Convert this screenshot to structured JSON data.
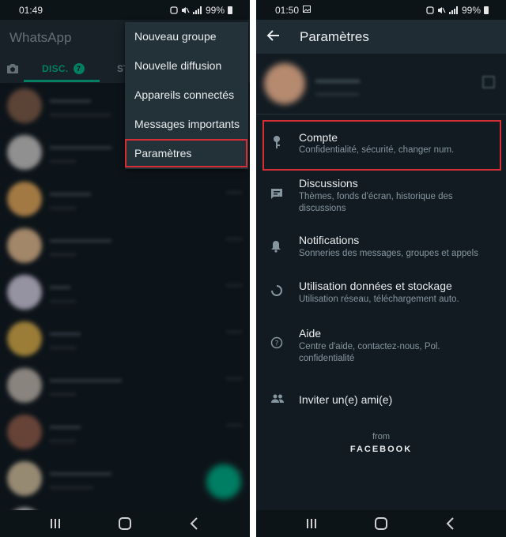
{
  "left_screen": {
    "status_bar": {
      "time": "01:49",
      "battery": "99%"
    },
    "app_title": "WhatsApp",
    "tabs": {
      "disc_label": "DISC.",
      "disc_badge": "7",
      "status_label": "ST"
    },
    "menu": {
      "items": [
        {
          "label": "Nouveau groupe"
        },
        {
          "label": "Nouvelle diffusion"
        },
        {
          "label": "Appareils connectés"
        },
        {
          "label": "Messages importants"
        },
        {
          "label": "Paramètres"
        }
      ],
      "highlighted_item": "Paramètres"
    },
    "chats_blurred": true
  },
  "right_screen": {
    "status_bar": {
      "time": "01:50",
      "battery": "99%"
    },
    "title": "Paramètres",
    "settings": [
      {
        "title": "Compte",
        "subtitle": "Confidentialité, sécurité, changer num.",
        "icon": "key-icon",
        "highlighted": true
      },
      {
        "title": "Discussions",
        "subtitle": "Thèmes, fonds d'écran, historique des discussions",
        "icon": "chat-icon"
      },
      {
        "title": "Notifications",
        "subtitle": "Sonneries des messages, groupes et appels",
        "icon": "bell-icon"
      },
      {
        "title": "Utilisation données et stockage",
        "subtitle": "Utilisation réseau, téléchargement auto.",
        "icon": "data-usage-icon"
      },
      {
        "title": "Aide",
        "subtitle": "Centre d'aide, contactez-nous, Pol. confidentialité",
        "icon": "help-icon"
      },
      {
        "title": "Inviter un(e) ami(e)",
        "icon": "people-icon"
      }
    ],
    "footer": {
      "from": "from",
      "brand": "FACEBOOK"
    }
  },
  "colors": {
    "background": "#121b22",
    "appbar": "#1f2c34",
    "accent": "#00a884",
    "highlight_border": "#d62e37",
    "primary_text": "#e9edef",
    "secondary_text": "#8696a0"
  }
}
